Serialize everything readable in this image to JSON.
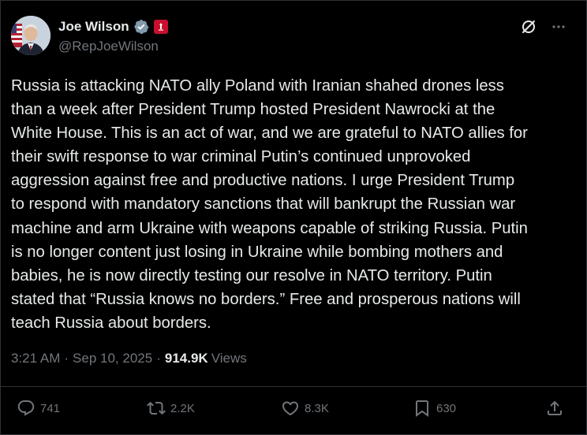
{
  "author": {
    "display_name": "Joe Wilson",
    "handle": "@RepJoeWilson"
  },
  "post": {
    "text": "Russia is attacking NATO ally Poland with Iranian shahed drones less\nthan a week after President Trump hosted President Nawrocki at the\nWhite House. This is an act of war, and we are grateful to NATO allies for\ntheir swift response to war criminal Putin’s continued unprovoked\naggression against free and productive nations. I urge President Trump\nto respond with mandatory sanctions that will bankrupt the Russian war\nmachine and arm Ukraine with weapons capable of striking Russia. Putin\nis no longer content just losing in Ukraine while bombing mothers and\nbabies, he is now directly testing our resolve in NATO territory. Putin\nstated that “Russia knows no borders.” Free and prosperous nations will\nteach Russia about borders.",
    "time": "3:21 AM",
    "date": "Sep 10, 2025",
    "separator": "·",
    "views_count": "914.9K",
    "views_label": "Views"
  },
  "stats": {
    "replies": "741",
    "reposts": "2.2K",
    "likes": "8.3K",
    "bookmarks": "630"
  },
  "colors": {
    "background": "#000000",
    "text": "#e7e9ea",
    "muted": "#71767b",
    "verified": "#829aab",
    "gov_badge": "#c8102e"
  },
  "icons": [
    "verified-badge-icon",
    "government-badge-icon",
    "grok-icon",
    "more-icon",
    "reply-icon",
    "repost-icon",
    "like-icon",
    "bookmark-icon",
    "share-icon"
  ]
}
